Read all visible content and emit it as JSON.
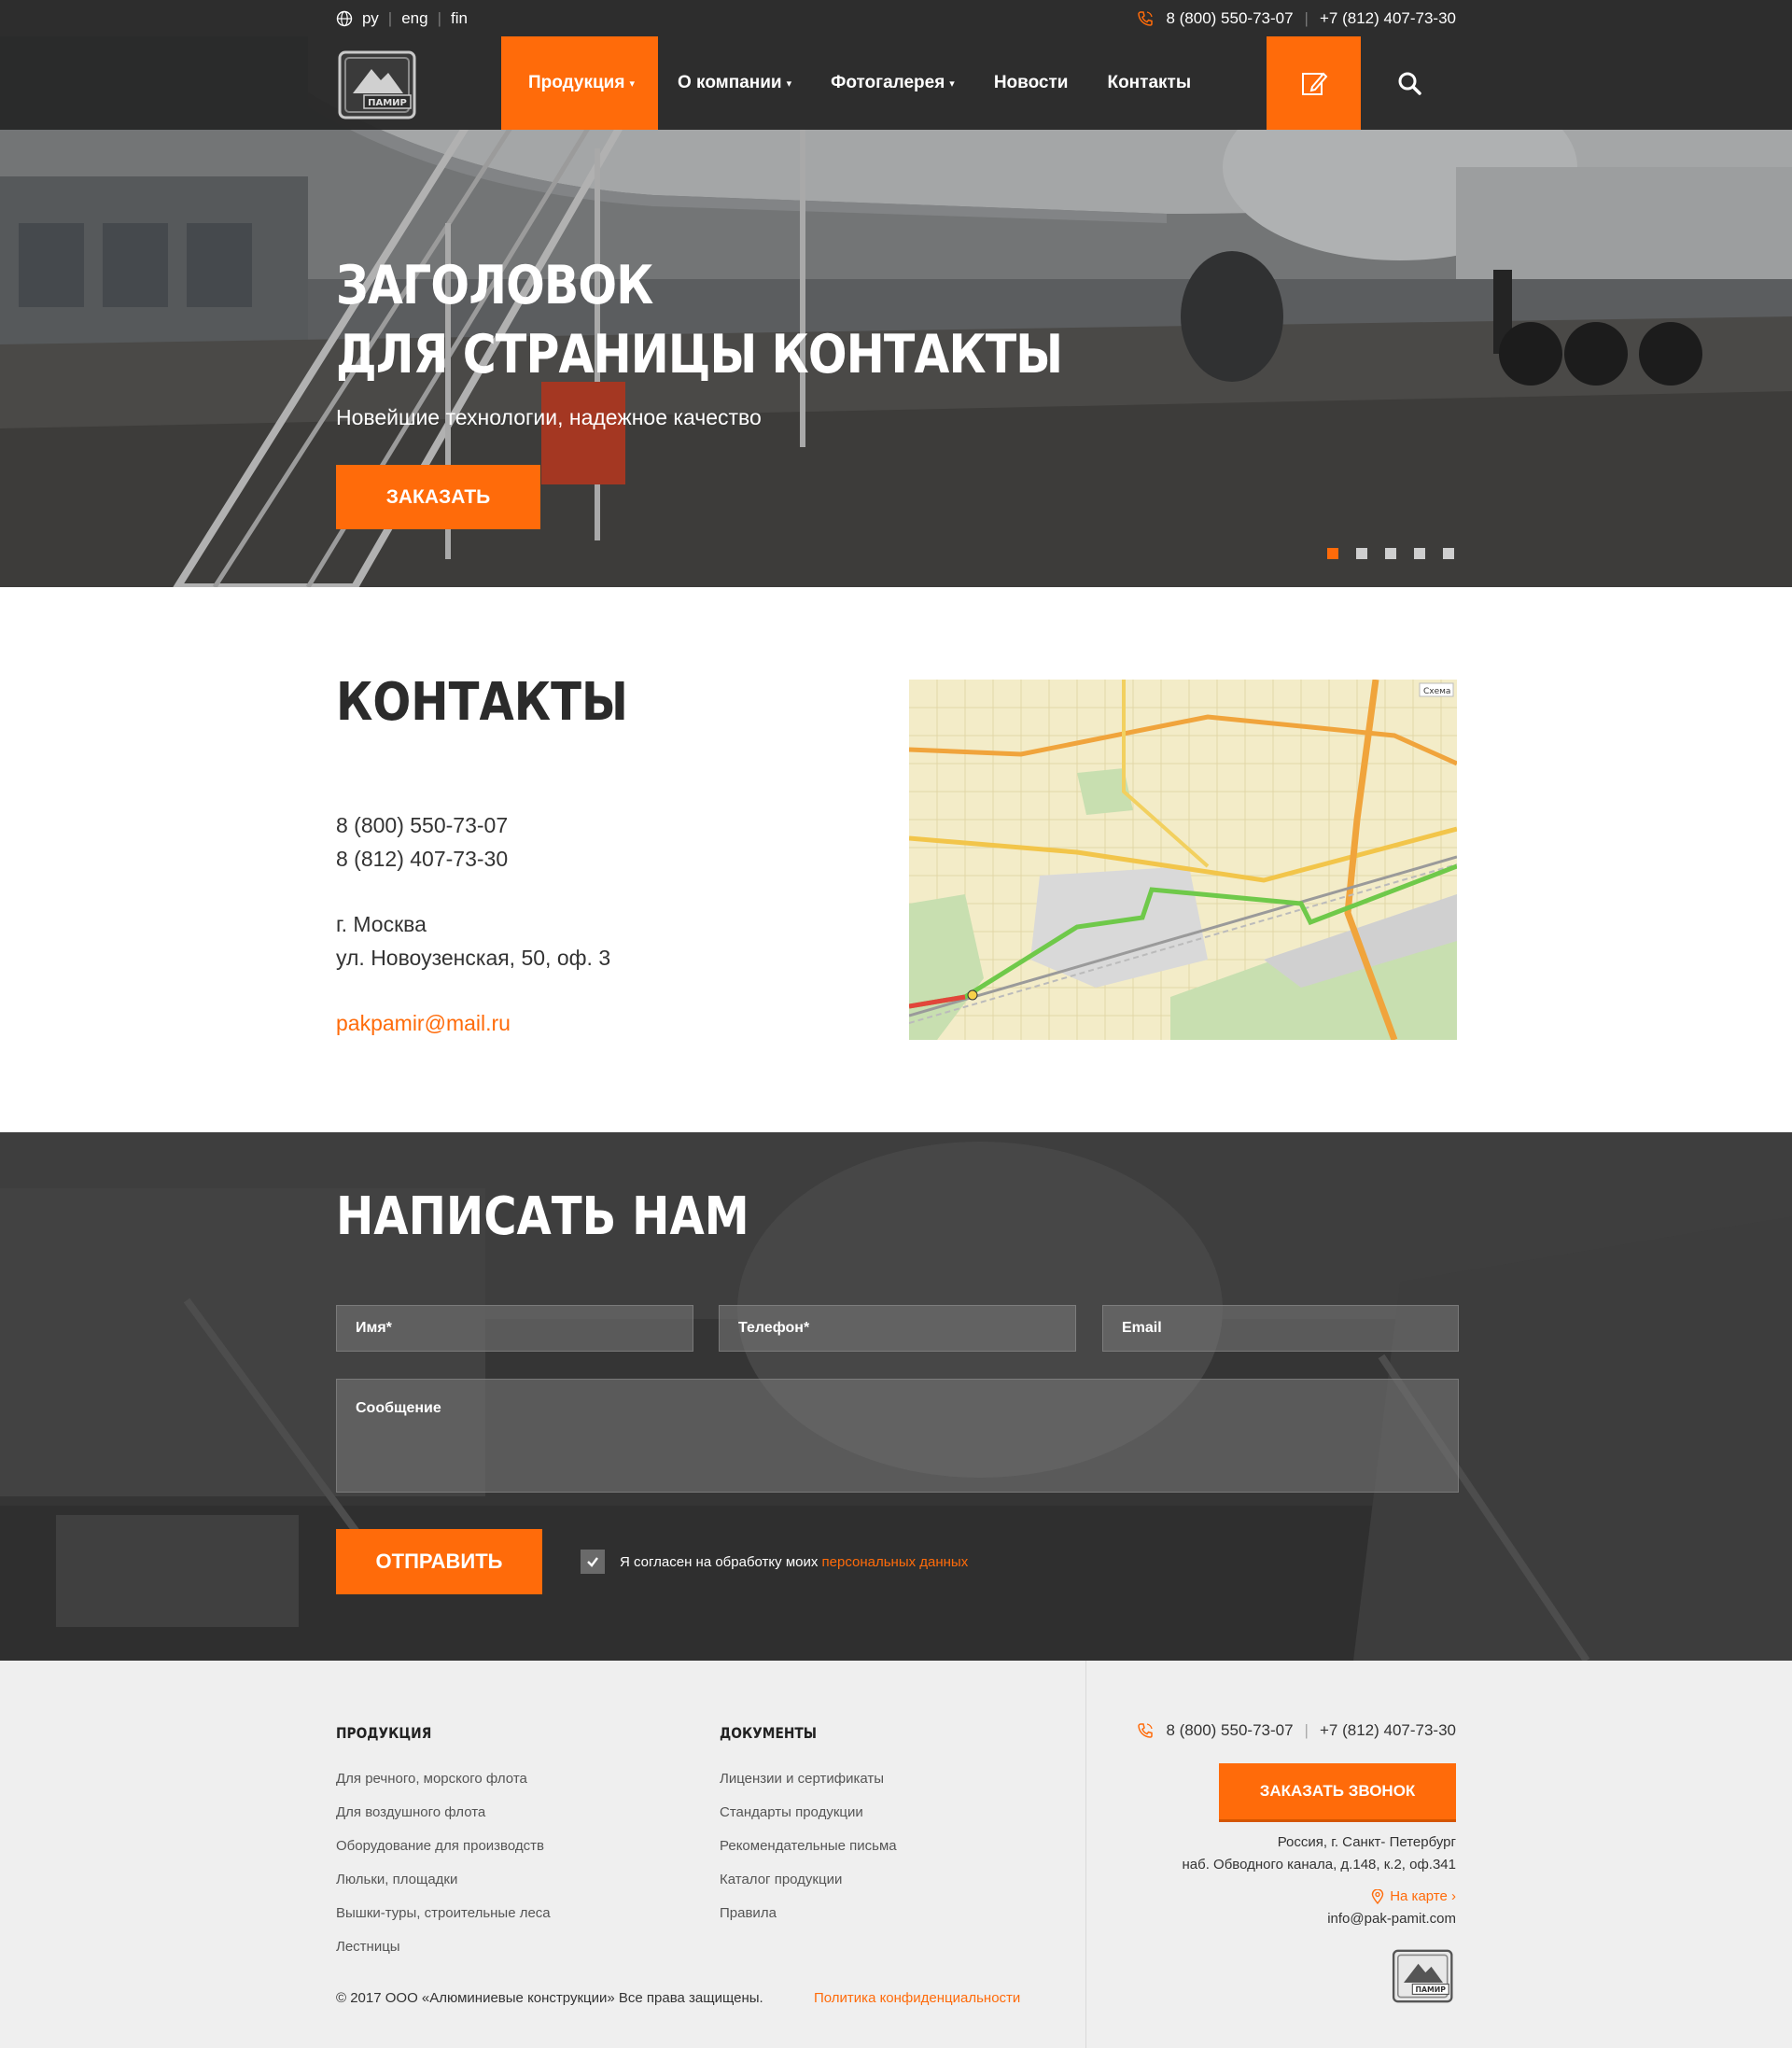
{
  "topbar": {
    "langs": [
      "ру",
      "eng",
      "fin"
    ],
    "phone1": "8 (800) 550-73-07",
    "phone2": "+7 (812) 407-73-30"
  },
  "logo": {
    "text": "ПАМИР"
  },
  "nav": {
    "items": [
      {
        "label": "Продукция",
        "caret": "▾"
      },
      {
        "label": "О компании",
        "caret": "▾"
      },
      {
        "label": "Фотогалерея",
        "caret": "▾"
      },
      {
        "label": "Новости",
        "caret": ""
      },
      {
        "label": "Контакты",
        "caret": ""
      }
    ]
  },
  "hero": {
    "title_line1": "ЗАГОЛОВОК",
    "title_line2": "ДЛЯ СТРАНИЦЫ КОНТАКТЫ",
    "subtitle": "Новейшие технологии, надежное качество",
    "button": "ЗАКАЗАТЬ",
    "slides": 5,
    "active_slide": 1
  },
  "contacts": {
    "title": "КОНТАКТЫ",
    "phone1": "8 (800) 550-73-07",
    "phone2": "8 (812) 407-73-30",
    "city": "г. Москва",
    "street": "ул. Новоузенская, 50, оф. 3",
    "email": "pakpamir@mail.ru",
    "map_mode": "Схема"
  },
  "form": {
    "title": "НАПИСАТЬ НАМ",
    "name_placeholder": "Имя*",
    "phone_placeholder": "Телефон*",
    "email_placeholder": "Email",
    "message_placeholder": "Сообщение",
    "submit": "ОТПРАВИТЬ",
    "agree_text": "Я согласен на обработку моих ",
    "agree_link": "персональных данных",
    "agree_checked": true
  },
  "footer": {
    "col1": {
      "title": "ПРОДУКЦИЯ",
      "items": [
        "Для речного, морского флота",
        "Для воздушного флота",
        "Оборудование для производств",
        "Люльки, площадки",
        "Вышки-туры, строительные леса",
        "Лестницы"
      ]
    },
    "col2": {
      "title": "ДОКУМЕНТЫ",
      "items": [
        "Лицензии и сертификаты",
        "Стандарты продукции",
        "Рекомендательные письма",
        "Каталог продукции",
        "Правила"
      ]
    },
    "copyright": "© 2017 ООО «Алюминиевые конструкции» Все права защищены.",
    "policy": "Политика конфиденциальности",
    "phone1": "8 (800) 550-73-07",
    "phone2": "+7 (812) 407-73-30",
    "call_button": "ЗАКАЗАТЬ ЗВОНОК",
    "address_line1": "Россия, г. Санкт- Петербург",
    "address_line2": "наб. Обводного канала, д.148, к.2, оф.341",
    "map_link": "На карте ›",
    "email": "info@pak-pamit.com"
  },
  "colors": {
    "accent": "#ff6b0a",
    "dark": "#2d2d2d"
  }
}
